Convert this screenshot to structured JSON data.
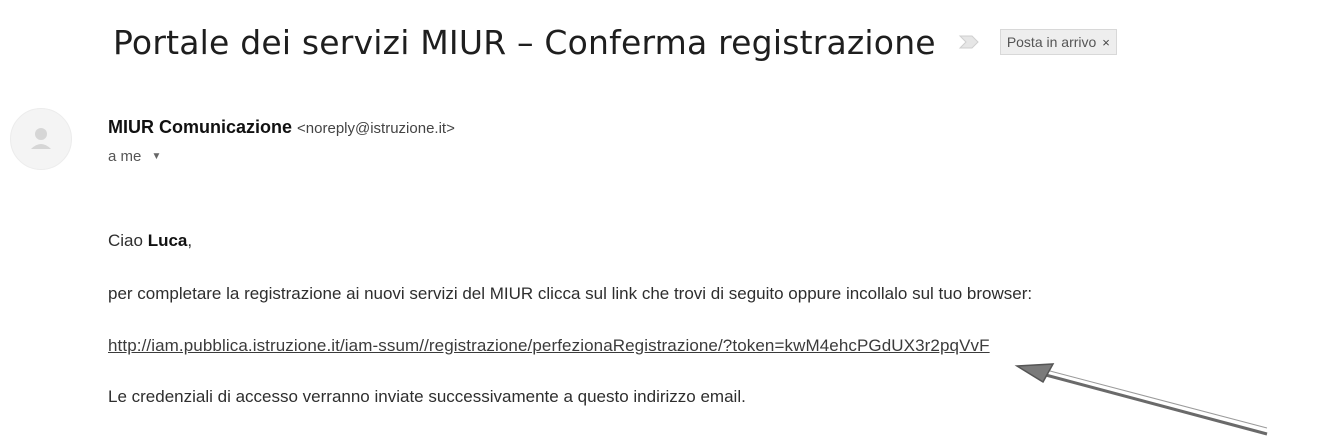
{
  "email": {
    "subject": "Portale dei servizi MIUR – Conferma registrazione",
    "label": "Posta in arrivo",
    "label_close": "×",
    "sender_name": "MIUR Comunicazione",
    "sender_email": "<noreply@istruzione.it>",
    "recipient": "a me",
    "recipient_caret": "▼",
    "greeting_prefix": "Ciao ",
    "greeting_name": "Luca",
    "greeting_suffix": ",",
    "line1": "per completare la registrazione ai nuovi servizi del MIUR clicca sul link che trovi di seguito oppure incollalo sul tuo browser:",
    "link": "http://iam.pubblica.istruzione.it/iam-ssum//registrazione/perfezionaRegistrazione/?token=kwM4ehcPGdUX3r2pqVvF",
    "line3": "Le credenziali di accesso verranno inviate successivamente a questo indirizzo email."
  },
  "icons": {
    "importance": "importance-marker-icon",
    "avatar": "user-avatar-icon",
    "arrow": "annotation-arrow"
  }
}
